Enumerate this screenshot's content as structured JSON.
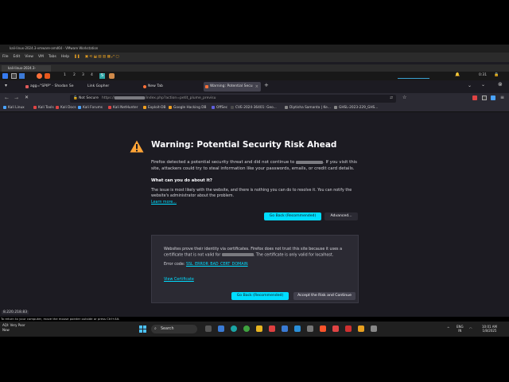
{
  "vmware": {
    "title": "kali-linux-2024.3-vmware-amd64 - VMware Workstation",
    "menu": [
      "File",
      "Edit",
      "View",
      "VM",
      "Tabs",
      "Help"
    ],
    "tab": "kali-linux-2024.3-vmware..."
  },
  "kali_panel": {
    "workspaces": [
      "1",
      "2",
      "3",
      "4"
    ],
    "clock": "0:31"
  },
  "firefox": {
    "tabs": [
      {
        "label": "agg=\"SPIP\" - Shodan Se",
        "color": "#e05a5a",
        "active": false
      },
      {
        "label": "Link Gopher",
        "color": "#555555",
        "active": false
      },
      {
        "label": "New Tab",
        "color": "#ff7139",
        "active": false
      },
      {
        "label": "Warning: Potential Secu",
        "color": "#ff7139",
        "active": true
      }
    ],
    "new_tab": "+",
    "url": {
      "security_label": "Not Secure",
      "prefix": "https://",
      "suffix": "/index.php?action=petit_plume_previsu"
    },
    "bookmarks": [
      {
        "label": "Kali Linux",
        "color": "#4aa3ff"
      },
      {
        "label": "Kali Tools",
        "color": "#e04444"
      },
      {
        "label": "Kali Docs",
        "color": "#e04444"
      },
      {
        "label": "Kali Forums",
        "color": "#4aa3ff"
      },
      {
        "label": "Kali NetHunter",
        "color": "#e04444"
      },
      {
        "label": "Exploit-DB",
        "color": "#f0a020"
      },
      {
        "label": "Google Hacking DB",
        "color": "#f0a020"
      },
      {
        "label": "OffSec",
        "color": "#6060e0"
      },
      {
        "label": "CVE-2024-36401: Geo...",
        "color": "#4a4a4a"
      },
      {
        "label": "Diptisha Samanta | Ke...",
        "color": "#888888"
      },
      {
        "label": "GHSL-2023-229_GHS...",
        "color": "#888888"
      }
    ]
  },
  "page": {
    "title": "Warning: Potential Security Risk Ahead",
    "intro_a": "Firefox detected a potential security threat and did not continue to",
    "intro_b": ". If you visit this site, attackers could try to steal information like your passwords, emails, or credit card details.",
    "what_heading": "What can you do about it?",
    "what_text": "The issue is most likely with the website, and there is nothing you can do to resolve it. You can notify the website's administrator about the problem.",
    "learn_more": "Learn more...",
    "go_back": "Go Back (Recommended)",
    "advanced": "Advanced...",
    "adv_text_a": "Websites prove their identity via certificates. Firefox does not trust this site because it uses a certificate that is not valid for",
    "adv_text_b": ". The certificate is only valid for localhost.",
    "error_code_label": "Error code:",
    "error_code": "SSL_ERROR_BAD_CERT_DOMAIN",
    "view_certificate": "View Certificate",
    "accept": "Accept the Risk and Continue"
  },
  "status_bar": "8.220.218.83",
  "vm_hint": "To return to your computer, move the mouse pointer outside or press Ctrl+Alt.",
  "taskbar": {
    "weather_temp": "AQI: Very Poor",
    "weather_sub": "Now",
    "search": "Search",
    "lang": "ENG",
    "lang_sub": "IN",
    "time": "10:01 AM",
    "date": "1/8/2025"
  }
}
